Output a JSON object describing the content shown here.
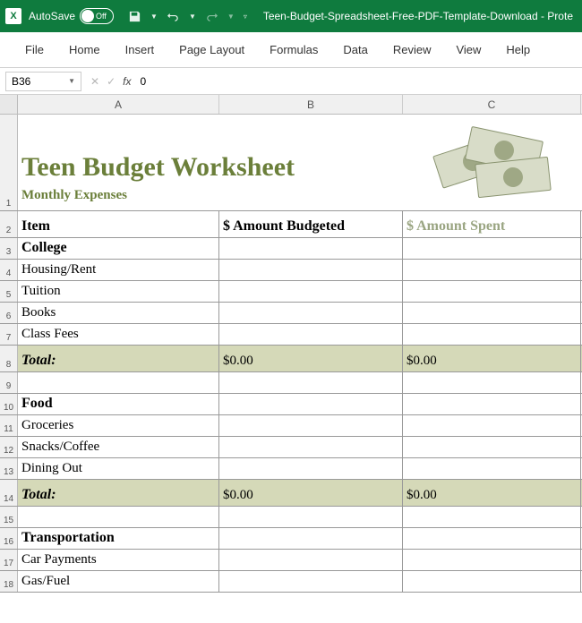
{
  "titlebar": {
    "autosave_label": "AutoSave",
    "autosave_state": "Off",
    "doc_title": "Teen-Budget-Spreadsheet-Free-PDF-Template-Download  -  Prote"
  },
  "ribbon": {
    "tabs": [
      "File",
      "Home",
      "Insert",
      "Page Layout",
      "Formulas",
      "Data",
      "Review",
      "View",
      "Help"
    ]
  },
  "namebox": {
    "cell": "B36",
    "formula": "0",
    "fx": "fx"
  },
  "columns": [
    "A",
    "B",
    "C"
  ],
  "worksheet": {
    "title": "Teen Budget Worksheet",
    "subtitle": "Monthly Expenses",
    "header": {
      "item": "Item",
      "budgeted": "$ Amount Budgeted",
      "spent": "$ Amount Spent"
    },
    "rows": [
      {
        "n": "3",
        "a": "College",
        "cat": true
      },
      {
        "n": "4",
        "a": "Housing/Rent"
      },
      {
        "n": "5",
        "a": "Tuition"
      },
      {
        "n": "6",
        "a": "Books"
      },
      {
        "n": "7",
        "a": "Class Fees"
      },
      {
        "n": "8",
        "a": "Total:",
        "b": "$0.00",
        "c": "$0.00",
        "total": true
      },
      {
        "n": "9",
        "a": ""
      },
      {
        "n": "10",
        "a": "Food",
        "cat": true
      },
      {
        "n": "11",
        "a": "Groceries"
      },
      {
        "n": "12",
        "a": "Snacks/Coffee"
      },
      {
        "n": "13",
        "a": "Dining Out"
      },
      {
        "n": "14",
        "a": "Total:",
        "b": "$0.00",
        "c": "$0.00",
        "total": true
      },
      {
        "n": "15",
        "a": ""
      },
      {
        "n": "16",
        "a": "Transportation",
        "cat": true
      },
      {
        "n": "17",
        "a": "Car Payments"
      },
      {
        "n": "18",
        "a": "Gas/Fuel"
      }
    ]
  }
}
